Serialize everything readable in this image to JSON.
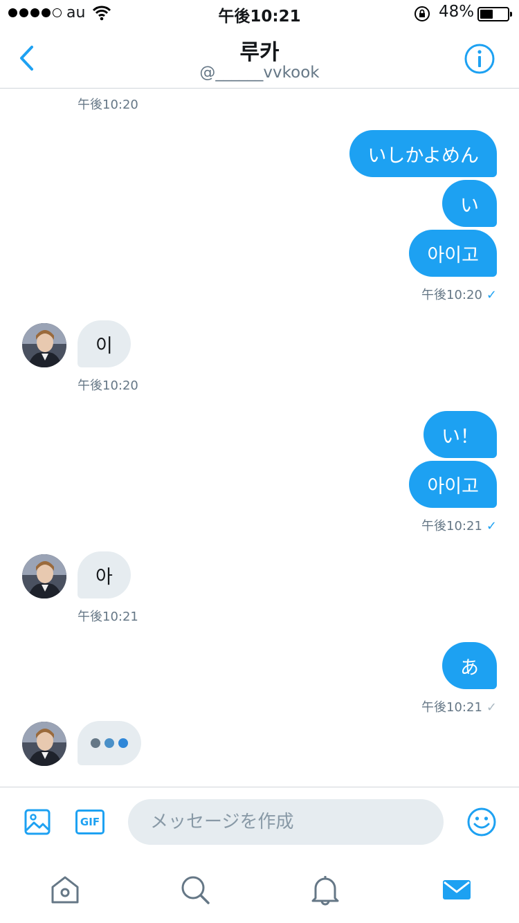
{
  "status_bar": {
    "carrier": "au",
    "time": "午後10:21",
    "battery": "48%",
    "battery_level": 0.48
  },
  "header": {
    "name": "루카",
    "handle": "@______vvkook",
    "back_icon": "chevron-left-icon",
    "info_icon": "info-icon"
  },
  "conversation": {
    "top_timestamp": "午後10:20",
    "group1": {
      "messages": [
        "いしかよめん",
        "い",
        "아이고"
      ],
      "timestamp": "午後10:20",
      "check": "✓"
    },
    "group2": {
      "messages": [
        "이"
      ],
      "timestamp": "午後10:20"
    },
    "group3": {
      "messages": [
        "い！",
        "아이고"
      ],
      "timestamp": "午後10:21",
      "check": "✓"
    },
    "group4": {
      "messages": [
        "아"
      ],
      "timestamp": "午後10:21"
    },
    "group5": {
      "messages": [
        "あ"
      ],
      "timestamp": "午後10:21",
      "check": "✓"
    }
  },
  "composer": {
    "placeholder": "メッセージを作成",
    "gif_label": "GIF"
  },
  "tabbar": {
    "items": [
      "home-icon",
      "search-icon",
      "bell-icon",
      "mail-icon"
    ],
    "active": "mail-icon"
  },
  "colors": {
    "accent": "#1da1f2",
    "bubble_in": "#e6ecf0",
    "muted": "#657786",
    "icon_gray": "#657786"
  }
}
